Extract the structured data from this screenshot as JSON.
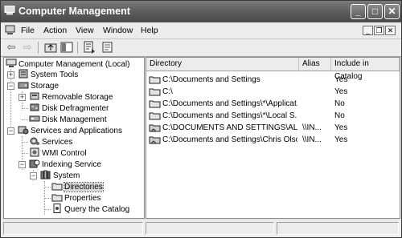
{
  "window": {
    "title": "Computer Management"
  },
  "menu": {
    "items": [
      "File",
      "Action",
      "View",
      "Window",
      "Help"
    ]
  },
  "toolbar": {
    "icons": [
      "back-arrow-icon",
      "forward-arrow-icon",
      "up-folder-icon",
      "show-hide-tree-icon",
      "export-list-icon",
      "properties-icon"
    ]
  },
  "tree": {
    "root": "Computer Management (Local)",
    "items": {
      "system_tools": "System Tools",
      "storage": "Storage",
      "removable_storage": "Removable Storage",
      "disk_defragmenter": "Disk Defragmenter",
      "disk_management": "Disk Management",
      "services_apps": "Services and Applications",
      "services": "Services",
      "wmi_control": "WMI Control",
      "indexing_service": "Indexing Service",
      "system": "System",
      "directories": "Directories",
      "properties": "Properties",
      "query": "Query the Catalog"
    },
    "selected": "Directories"
  },
  "list": {
    "columns": [
      "Directory",
      "Alias",
      "Include in Catalog"
    ],
    "rows": [
      {
        "directory": "C:\\Documents and Settings",
        "alias": "",
        "include": "Yes"
      },
      {
        "directory": "C:\\",
        "alias": "",
        "include": "Yes"
      },
      {
        "directory": "C:\\Documents and Settings\\*\\Applicat...",
        "alias": "",
        "include": "No"
      },
      {
        "directory": "C:\\Documents and Settings\\*\\Local S...",
        "alias": "",
        "include": "No"
      },
      {
        "directory": "C:\\DOCUMENTS AND SETTINGS\\ALL U...",
        "alias": "\\\\IN...",
        "include": "Yes"
      },
      {
        "directory": "C:\\Documents and Settings\\Chris Olso...",
        "alias": "\\\\IN...",
        "include": "Yes"
      }
    ]
  }
}
